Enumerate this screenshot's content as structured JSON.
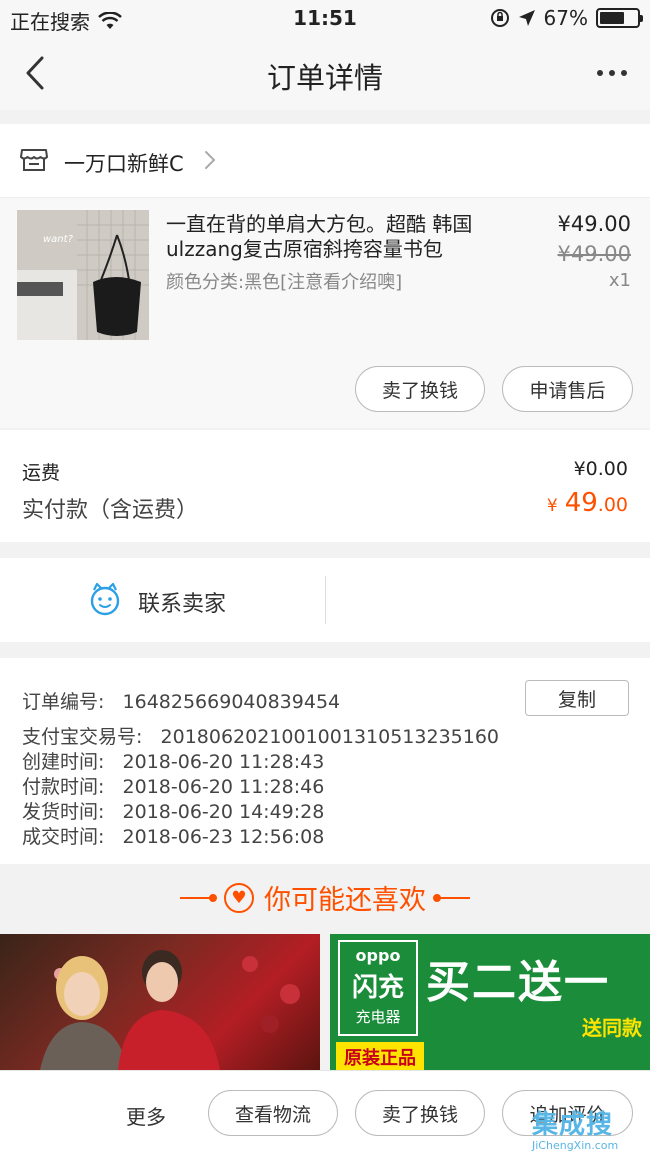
{
  "status_bar": {
    "carrier": "正在搜索",
    "time": "11:51",
    "battery": "67%",
    "battery_level": 0.67,
    "icons": [
      "wifi-icon",
      "orientation-lock-icon",
      "location-icon",
      "battery-icon"
    ]
  },
  "nav": {
    "title": "订单详情",
    "icons": [
      "back-icon",
      "more-icon"
    ]
  },
  "shop": {
    "name": "一万口新鲜C",
    "icons": [
      "shop-icon",
      "chevron-right-icon"
    ]
  },
  "product": {
    "name": "一直在背的单肩大方包。超酷 韩国ulzzang复古原宿斜挎容量书包",
    "sku": "颜色分类:黑色[注意看介绍噢]",
    "price": "¥49.00",
    "original_price": "¥49.00",
    "quantity": "x1",
    "image_label": "want?",
    "buttons": {
      "sell": "卖了换钱",
      "after_sale": "申请售后"
    }
  },
  "fees": {
    "shipping_label": "运费",
    "shipping_value": "¥0.00",
    "paid_label": "实付款（含运费）",
    "paid_currency": "¥",
    "paid_integer": "49",
    "paid_decimal": ".00"
  },
  "contact": {
    "label": "联系卖家",
    "icon": "seller-chat-icon"
  },
  "order": {
    "order_no_label": "订单编号:",
    "order_no": "164825669040839454",
    "copy_label": "复制",
    "alipay_label": "支付宝交易号:",
    "alipay_no": "2018062021001001310513235160",
    "created_label": "创建时间:",
    "created": "2018-06-20 11:28:43",
    "paid_label": "付款时间:",
    "paid": "2018-06-20 11:28:46",
    "shipped_label": "发货时间:",
    "shipped": "2018-06-20 14:49:28",
    "completed_label": "成交时间:",
    "completed": "2018-06-23 12:56:08"
  },
  "recommend": {
    "title": "你可能还喜欢",
    "ad": {
      "brand": "oppo",
      "brand_big": "闪充",
      "brand_sub": "充电器",
      "headline": "买二送一",
      "sub": "送同款",
      "tag": "原装正品"
    }
  },
  "bottom": {
    "more": "更多",
    "logistics": "查看物流",
    "sell": "卖了换钱",
    "review": "追加评价"
  },
  "watermark": {
    "text": "集成搜",
    "url": "JiChengXin.com"
  },
  "colors": {
    "accent": "#ff5000",
    "contact_icon": "#2ba0e6",
    "ad_green": "#1a8c3a",
    "ad_yellow": "#ffe400"
  }
}
